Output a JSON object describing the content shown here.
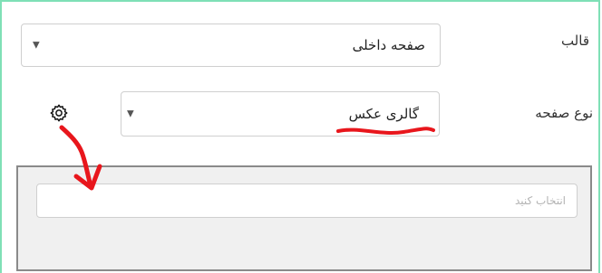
{
  "form": {
    "template": {
      "label": "قالب",
      "value": "صفحه داخلی"
    },
    "page_type": {
      "label": "نوع صفحه",
      "value": "گالری عکس"
    },
    "picker": {
      "placeholder": "انتخاب کنید"
    }
  },
  "icons": {
    "settings": "gear-icon",
    "dropdown": "caret-down-icon"
  },
  "colors": {
    "frame_border": "#7fe0b6",
    "annotation": "#e8161c",
    "panel_bg": "#f0f0f0"
  }
}
